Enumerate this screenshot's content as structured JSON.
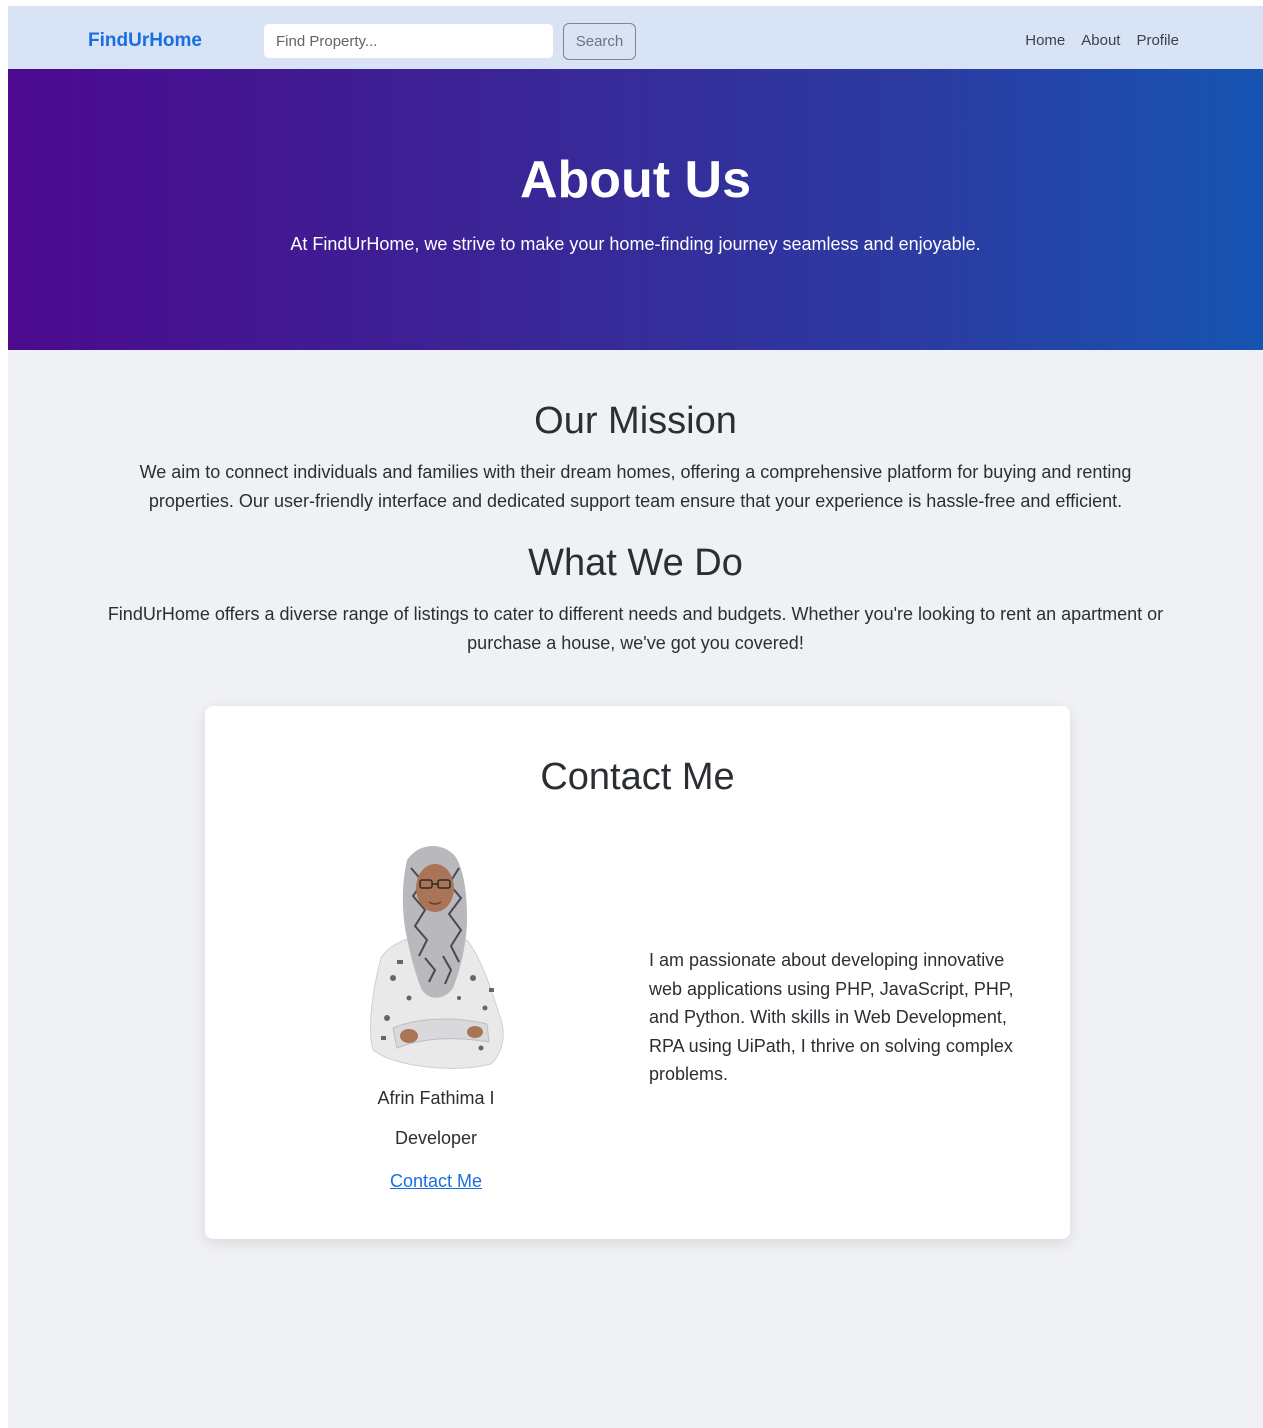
{
  "navbar": {
    "brand": "FindUrHome",
    "search_placeholder": "Find Property...",
    "search_button": "Search",
    "links": [
      "Home",
      "About",
      "Profile"
    ]
  },
  "hero": {
    "title": "About Us",
    "subtitle": "At FindUrHome, we strive to make your home-finding journey seamless and enjoyable."
  },
  "mission": {
    "title": "Our Mission",
    "text": "We aim to connect individuals and families with their dream homes, offering a comprehensive platform for buying and renting properties. Our user-friendly interface and dedicated support team ensure that your experience is hassle-free and efficient."
  },
  "what_we_do": {
    "title": "What We Do",
    "text": "FindUrHome offers a diverse range of listings to cater to different needs and budgets. Whether you're looking to rent an apartment or purchase a house, we've got you covered!"
  },
  "contact": {
    "title": "Contact Me",
    "name": "Afrin Fathima I",
    "role": "Developer",
    "link": "Contact Me",
    "bio": "I am passionate about developing innovative web applications using PHP, JavaScript, PHP, and Python. With skills in Web Development, RPA using UiPath, I thrive on solving complex problems."
  },
  "colors": {
    "brand": "#1a6fe0",
    "navbar_bg": "#d8e4f6",
    "hero_start": "#4c0a8f",
    "hero_end": "#1654b1",
    "page_bg": "#f0f1f4"
  }
}
